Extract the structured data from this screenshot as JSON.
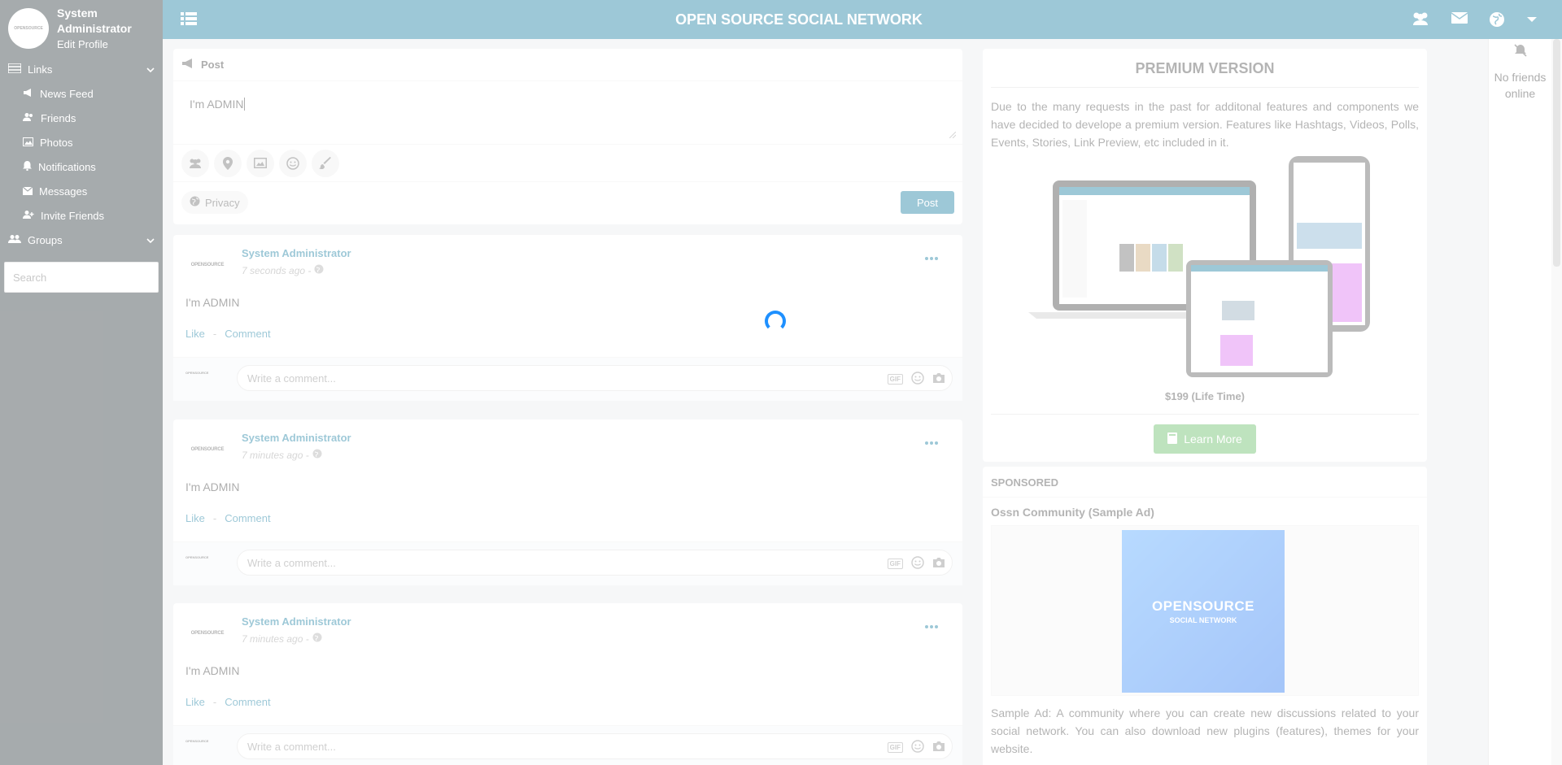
{
  "sidebar": {
    "profile": {
      "name_line1": "System",
      "name_line2": "Administrator",
      "edit_label": "Edit Profile",
      "avatar_text": "OPENSOURCE"
    },
    "links_label": "Links",
    "items": [
      {
        "label": "News Feed",
        "icon": "bullhorn-icon"
      },
      {
        "label": "Friends",
        "icon": "users-icon"
      },
      {
        "label": "Photos",
        "icon": "image-icon"
      },
      {
        "label": "Notifications",
        "icon": "bell-icon"
      },
      {
        "label": "Messages",
        "icon": "envelope-icon"
      },
      {
        "label": "Invite Friends",
        "icon": "user-plus-icon"
      }
    ],
    "groups_label": "Groups",
    "search_placeholder": "Search"
  },
  "topbar": {
    "title": "OPEN SOURCE SOCIAL NETWORK"
  },
  "composer": {
    "header": "Post",
    "text": "I'm ADMIN",
    "privacy_label": "Privacy",
    "post_label": "Post"
  },
  "posts": [
    {
      "author": "System Administrator",
      "time": "7 seconds ago -",
      "body": "I'm ADMIN",
      "like": "Like",
      "comment": "Comment",
      "comment_placeholder": "Write a comment...",
      "logo": "OPENSOURCE"
    },
    {
      "author": "System Administrator",
      "time": "7 minutes ago -",
      "body": "I'm ADMIN",
      "like": "Like",
      "comment": "Comment",
      "comment_placeholder": "Write a comment...",
      "logo": "OPENSOURCE"
    },
    {
      "author": "System Administrator",
      "time": "7 minutes ago -",
      "body": "I'm ADMIN",
      "like": "Like",
      "comment": "Comment",
      "comment_placeholder": "Write a comment...",
      "logo": "OPENSOURCE"
    }
  ],
  "premium": {
    "title": "PREMIUM VERSION",
    "description": "Due to the many requests in the past for additonal features and components we have decided to develope a premium version. Features like Hashtags, Videos, Polls, Events, Stories, Link Preview, etc included in it.",
    "price": "$199 (Life Time)",
    "button": "Learn More"
  },
  "sponsored": {
    "header": "SPONSORED",
    "ad_title": "Ossn Community (Sample Ad)",
    "ad_logo_main": "OPENSOURCE",
    "ad_logo_sub": "SOCIAL NETWORK",
    "ad_description": "Sample Ad: A community where you can create new discussions related to your social network. You can also download new plugins (features), themes for your website."
  },
  "friends": {
    "status": "No friends online"
  },
  "colors": {
    "topbar": "#0b769c",
    "sidebar": "#222d32",
    "accent": "#0b769c",
    "learn_more": "#5cb85c"
  }
}
